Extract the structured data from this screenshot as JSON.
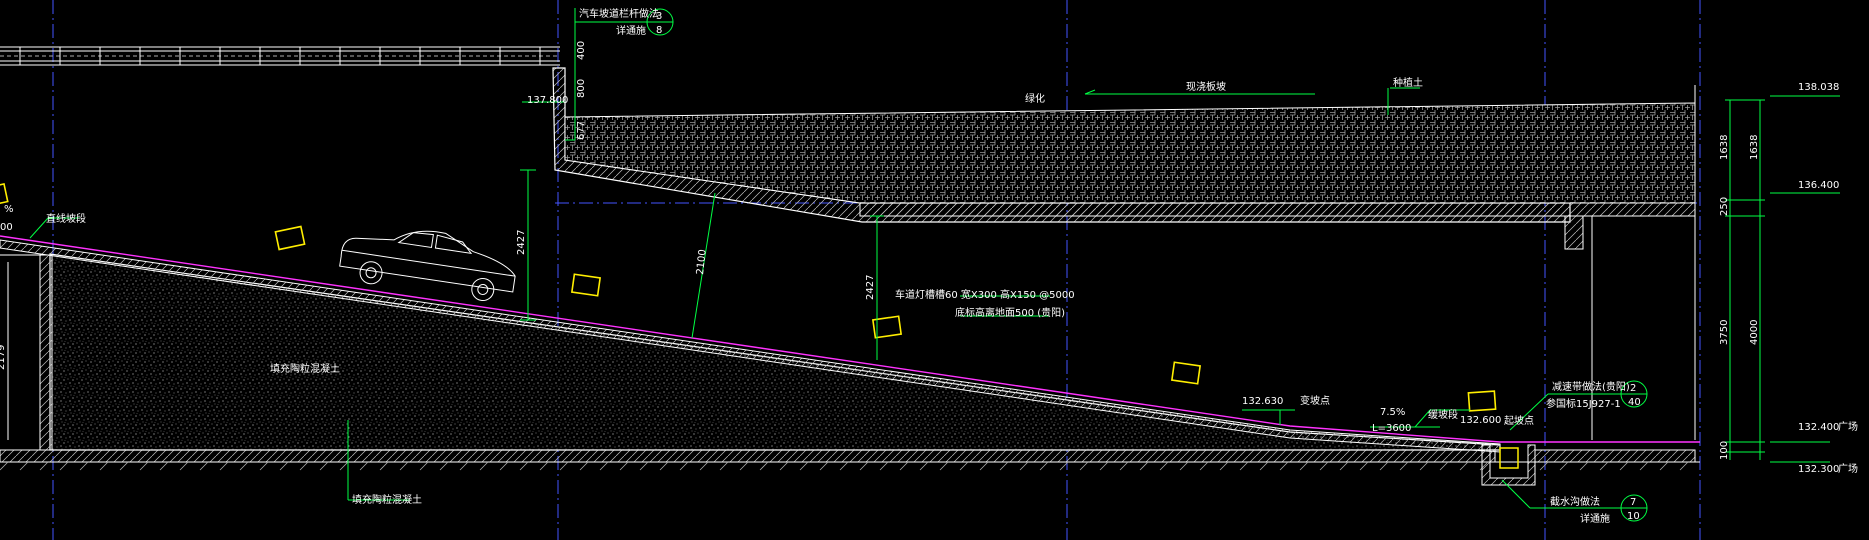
{
  "labels": {
    "car_slope_ref": "汽车坡道栏杆做法",
    "car_slope_ref_page": "详通施",
    "car_slope_ref_num": "3",
    "car_slope_ref_den": "8",
    "greening": "绿化",
    "cast_in_place": "现浇板坡",
    "planting_soil": "种植土",
    "slow_slope_top": "直线坡段",
    "fill_concrete_upper": "填充陶粒混凝土",
    "fill_concrete_lower": "填充陶粒混凝土",
    "light_slot_line1": "车道灯槽槽60  宽X300  高X150  @5000",
    "light_slot_line2": "底标高离地面500  (贵阳)",
    "slope_change_pt": "变坡点",
    "slope_pct": "7.5%",
    "slope_len": "L=3600",
    "slope_seg": "缓坡段",
    "start_pt": "起坡点",
    "deceleration_ref": "减速带做法(贵阳)",
    "deceleration_ref2": "参国标15J927-1",
    "deceleration_num": "2",
    "deceleration_den": "40",
    "drain_ref": "截水沟做法",
    "drain_ref_page": "详通施",
    "drain_num": "7",
    "drain_den": "10",
    "pct_left": "%",
    "pct_left2": "00"
  },
  "elevations": {
    "e137800": "137.800",
    "e132630": "132.630",
    "e132600": "132.600",
    "right_top": "138.038",
    "right_mid": "136.400",
    "right_low": "132.400",
    "right_base": "132.300",
    "right_low_tag": "广场",
    "right_base_tag": "广场"
  },
  "dims": {
    "d400": "400",
    "d800": "800",
    "d677": "677",
    "d2427a": "2427",
    "d2100": "2100",
    "d2427b": "2427",
    "r1638a": "1638",
    "r1638b": "1638",
    "r250": "250",
    "r3750": "3750",
    "r4000": "4000",
    "r100": "100",
    "left_dim": "2179"
  }
}
